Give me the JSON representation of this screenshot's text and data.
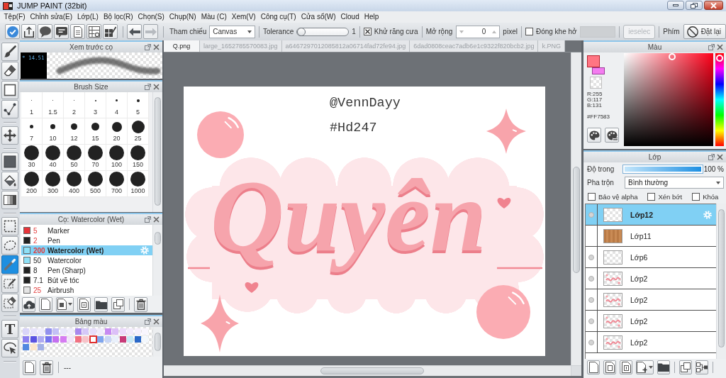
{
  "window": {
    "title": "JUMP PAINT (32bit)"
  },
  "menu": [
    "Tệp(F)",
    "Chỉnh sửa(E)",
    "Lớp(L)",
    "Bộ lọc(R)",
    "Chọn(S)",
    "Chụp(N)",
    "Màu (C)",
    "Xem(V)",
    "Công cụ(T)",
    "Cửa sổ(W)",
    "Cloud",
    "Help"
  ],
  "toolbar": {
    "history": [
      {
        "kind": "undo",
        "disabled": false
      },
      {
        "kind": "redo",
        "disabled": true
      }
    ],
    "reference": {
      "label": "Tham chiếu",
      "value": "Canvas"
    },
    "tolerance": {
      "label": "Tolerance",
      "level": 0,
      "reading": "1"
    },
    "antialias": {
      "label": "Khử răng cưa",
      "checked": true
    },
    "expand": {
      "label": "Mở rộng",
      "value": "0",
      "unit": "pixel"
    },
    "close_gap": {
      "label": "Đóng khe hở",
      "checked": false
    },
    "deselect": {
      "label": "ieselec",
      "disabled": true
    },
    "shortcut": {
      "label": "Phím",
      "button": "Đặt lại"
    }
  },
  "tool_groups": [
    {
      "tools": [
        {
          "kind": "brush",
          "selected": false
        },
        {
          "kind": "eraser",
          "selected": false
        },
        {
          "kind": "rectangle",
          "selected": false
        },
        {
          "kind": "polyline",
          "selected": false
        }
      ]
    },
    {
      "tools": [
        {
          "kind": "move",
          "selected": false
        }
      ]
    },
    {
      "tools": [
        {
          "kind": "fill",
          "selected": false
        },
        {
          "kind": "bucket",
          "selected": false
        },
        {
          "kind": "gradient",
          "selected": false
        }
      ]
    },
    {
      "tools": [
        {
          "kind": "select-rectangle",
          "selected": false
        },
        {
          "kind": "lasso",
          "selected": false
        },
        {
          "kind": "wand",
          "selected": true
        },
        {
          "kind": "select-pen",
          "selected": false
        },
        {
          "kind": "select-eraser",
          "selected": false
        }
      ]
    },
    {
      "tools": [
        {
          "kind": "text",
          "glyph": "T",
          "selected": false
        },
        {
          "kind": "lasso-pointer",
          "selected": false
        }
      ]
    }
  ],
  "brush_preview": {
    "title": "Xem trước cọ",
    "size": "* 14.51"
  },
  "brush_size": {
    "title": "Brush Size",
    "sizes": [
      "1",
      "1.5",
      "2",
      "3",
      "4",
      "5",
      "7",
      "10",
      "12",
      "15",
      "20",
      "25",
      "30",
      "40",
      "50",
      "70",
      "100",
      "150",
      "200",
      "300",
      "400",
      "500",
      "700",
      "1000"
    ]
  },
  "brush_list": {
    "title": "Cọ: Watercolor (Wet)",
    "brushes": [
      {
        "size": "5",
        "name": "Marker",
        "color": "#e8343a",
        "size_highlighted": true,
        "selected": false
      },
      {
        "size": "2",
        "name": "Pen",
        "color": "#222222",
        "size_highlighted": true,
        "selected": false
      },
      {
        "size": "200",
        "name": "Watercolor (Wet)",
        "color": "#8ee0f6",
        "size_highlighted": true,
        "selected": true
      },
      {
        "size": "50",
        "name": "Watercolor",
        "color": "#8ee0f6",
        "size_highlighted": false,
        "selected": false
      },
      {
        "size": "8",
        "name": "Pen (Sharp)",
        "color": "#222222",
        "size_highlighted": false,
        "selected": false
      },
      {
        "size": "7.1",
        "name": "Bút vẽ tóc",
        "color": "#222222",
        "size_highlighted": false,
        "selected": false
      },
      {
        "size": "25",
        "name": "Airbrush",
        "color": "#e4e4e4",
        "size_highlighted": true,
        "selected": false
      }
    ]
  },
  "palette": {
    "title": "Bảng màu",
    "swatches": [
      {
        "color": "#d9d5f8",
        "selected": false
      },
      {
        "color": "#e7e3fb",
        "selected": false
      },
      {
        "color": "#efecfc",
        "selected": false
      },
      {
        "color": "#9390ee",
        "selected": false
      },
      {
        "color": "#c3c1f5",
        "selected": false
      },
      {
        "color": "#e8e6fb",
        "selected": false
      },
      {
        "color": "#f0eefc",
        "selected": false
      },
      {
        "color": "#a888ee",
        "selected": false
      },
      {
        "color": "#d5c8f8",
        "selected": false
      },
      {
        "color": "#e6ddfa",
        "selected": false
      },
      {
        "color": "#f1ecfc",
        "selected": false
      },
      {
        "color": "#c78af2",
        "selected": false
      },
      {
        "color": "#dcc0f8",
        "selected": false
      },
      {
        "color": "#ecdbfb",
        "selected": false
      },
      {
        "color": "#f3ebfc",
        "selected": false
      },
      {
        "color": "#f6f0fd",
        "selected": false
      },
      {
        "color": "#f9f6fe",
        "selected": false
      },
      {
        "color": "#8c80f0",
        "selected": false
      },
      {
        "color": "#5a52e2",
        "selected": false
      },
      {
        "color": "#aeaaf2",
        "selected": false
      },
      {
        "color": "#7474ee",
        "selected": false
      },
      {
        "color": "#c470f0",
        "selected": false
      },
      {
        "color": "#d67cf2",
        "selected": false
      },
      {
        "color": "#f1e4f9",
        "selected": false
      },
      {
        "color": "#f17282",
        "selected": false
      },
      {
        "color": "#f8c2c8",
        "selected": false
      },
      {
        "color": "#ffffff",
        "selected": true
      },
      {
        "color": "#80a6ee",
        "selected": false
      },
      {
        "color": "#c8d6f6",
        "selected": false
      },
      {
        "color": "#e9f0fb",
        "selected": false
      },
      {
        "color": "#c83a78",
        "selected": false
      },
      {
        "color": "#c6e8f6",
        "selected": false
      },
      {
        "color": "#2a68c8",
        "selected": false
      },
      {
        "color": "#f3f7fc",
        "selected": false
      },
      {
        "color": "#5088e0",
        "selected": false
      },
      {
        "color": "#fce6cc",
        "selected": false
      },
      {
        "color": "#a2b0e6",
        "selected": false
      }
    ],
    "status": "---"
  },
  "canvas": {
    "tabs": [
      {
        "label": "Q.png",
        "selected": true
      },
      {
        "label": "large_1652785570083.jpg",
        "selected": false
      },
      {
        "label": "a6467297012085812a06714fad72fe94.jpg",
        "selected": false
      },
      {
        "label": "6dad0808ceac7adb6e1c9322f820bcb2.jpg",
        "selected": false
      },
      {
        "label": "k.PNG",
        "selected": false
      }
    ],
    "artwork": {
      "texts": [
        {
          "kind": "handle",
          "text": "@VennDayy"
        },
        {
          "kind": "tag",
          "text": "#Hd247"
        },
        {
          "kind": "lettering",
          "text": "Quyên"
        }
      ]
    }
  },
  "color_panel": {
    "title": "Màu",
    "swatches": [
      {
        "kind": "foreground",
        "color": "#ff7583"
      },
      {
        "kind": "background",
        "color": "#f47cf0"
      }
    ],
    "rgb": [
      "R:255",
      "G:117",
      "B:131"
    ],
    "hex": "#FF7583",
    "hue_slider": {
      "level": 0.98
    }
  },
  "layers": {
    "title": "Lớp",
    "opacity": {
      "label": "Độ trong",
      "level": 1,
      "reading": "100 %"
    },
    "blend": {
      "label": "Pha trộn",
      "value": "Bình thường"
    },
    "options": [
      {
        "label": "Bảo vệ alpha",
        "checked": false
      },
      {
        "label": "Xén bớt",
        "checked": false
      },
      {
        "label": "Khóa",
        "checked": false
      }
    ],
    "items": [
      {
        "name": "Lớp12",
        "kind": "transparent",
        "visible": true,
        "selected": true
      },
      {
        "name": "Lớp11",
        "kind": "wood",
        "visible": false,
        "selected": false
      },
      {
        "name": "Lớp6",
        "kind": "transparent",
        "visible": true,
        "selected": false
      },
      {
        "name": "Lớp2",
        "kind": "lettering",
        "visible": true,
        "selected": false
      },
      {
        "name": "Lớp2",
        "kind": "lettering",
        "visible": true,
        "selected": false
      },
      {
        "name": "Lớp2",
        "kind": "lettering",
        "visible": true,
        "selected": false
      },
      {
        "name": "Lớp2",
        "kind": "lettering",
        "visible": true,
        "selected": false
      }
    ]
  }
}
